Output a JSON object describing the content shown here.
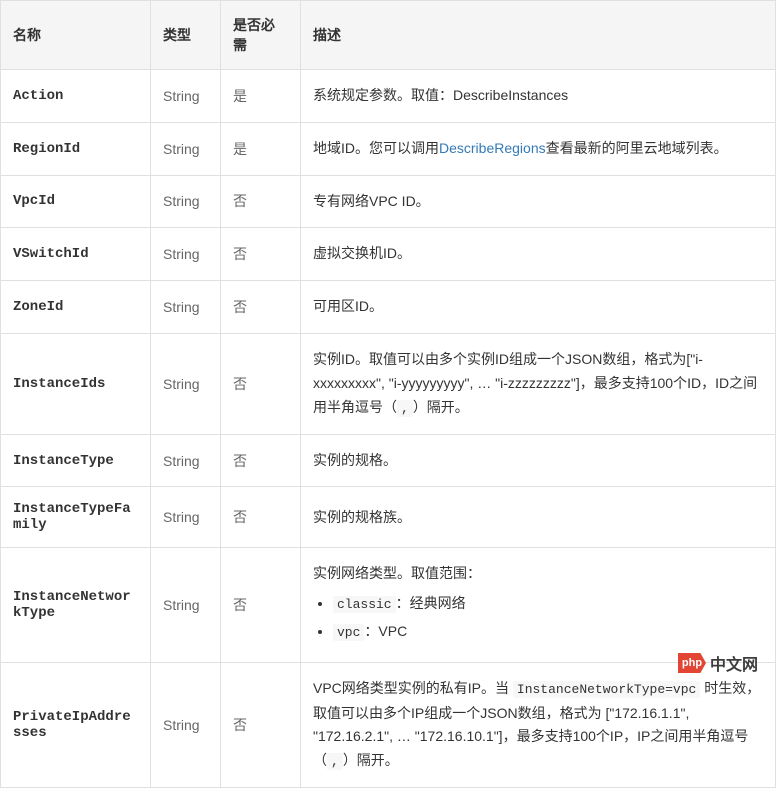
{
  "table": {
    "headers": [
      "名称",
      "类型",
      "是否必需",
      "描述"
    ],
    "rows": [
      {
        "name": "Action",
        "type": "String",
        "required": "是",
        "desc_type": "plain",
        "desc": "系统规定参数。取值：DescribeInstances"
      },
      {
        "name": "RegionId",
        "type": "String",
        "required": "是",
        "desc_type": "link",
        "desc_before": "地域ID。您可以调用",
        "desc_link_text": "DescribeRegions",
        "desc_after": "查看最新的阿里云地域列表。"
      },
      {
        "name": "VpcId",
        "type": "String",
        "required": "否",
        "desc_type": "plain",
        "desc": "专有网络VPC ID。"
      },
      {
        "name": "VSwitchId",
        "type": "String",
        "required": "否",
        "desc_type": "plain",
        "desc": "虚拟交换机ID。"
      },
      {
        "name": "ZoneId",
        "type": "String",
        "required": "否",
        "desc_type": "plain",
        "desc": "可用区ID。"
      },
      {
        "name": "InstanceIds",
        "type": "String",
        "required": "否",
        "desc_type": "code",
        "desc_before": "实例ID。取值可以由多个实例ID组成一个JSON数组，格式为[\"i-xxxxxxxxx\", \"i-yyyyyyyyy\", … \"i-zzzzzzzzz\"]，最多支持100个ID，ID之间用半角逗号（",
        "desc_code": ",",
        "desc_after": "）隔开。"
      },
      {
        "name": "InstanceType",
        "type": "String",
        "required": "否",
        "desc_type": "plain",
        "desc": "实例的规格。"
      },
      {
        "name": "InstanceTypeFamily",
        "type": "String",
        "required": "否",
        "desc_type": "plain",
        "desc": "实例的规格族。"
      },
      {
        "name": "InstanceNetworkType",
        "type": "String",
        "required": "否",
        "desc_type": "list",
        "desc_intro": "实例网络类型。取值范围：",
        "desc_items": [
          {
            "code": "classic",
            "text": "：经典网络"
          },
          {
            "code": "vpc",
            "text": "：VPC"
          }
        ]
      },
      {
        "name": "PrivateIpAddresses",
        "type": "String",
        "required": "否",
        "desc_type": "code2",
        "parts": [
          {
            "t": "text",
            "v": "VPC网络类型实例的私有IP。当 "
          },
          {
            "t": "code",
            "v": "InstanceNetworkType=vpc"
          },
          {
            "t": "text",
            "v": " 时生效，取值可以由多个IP组成一个JSON数组，格式为 [\"172.16.1.1\", \"172.16.2.1\", … \"172.16.10.1\"]，最多支持100个IP，IP之间用半角逗号（"
          },
          {
            "t": "code",
            "v": ","
          },
          {
            "t": "text",
            "v": "）隔开。"
          }
        ]
      }
    ]
  },
  "watermark": {
    "logo_text": "php",
    "text": "中文网"
  }
}
